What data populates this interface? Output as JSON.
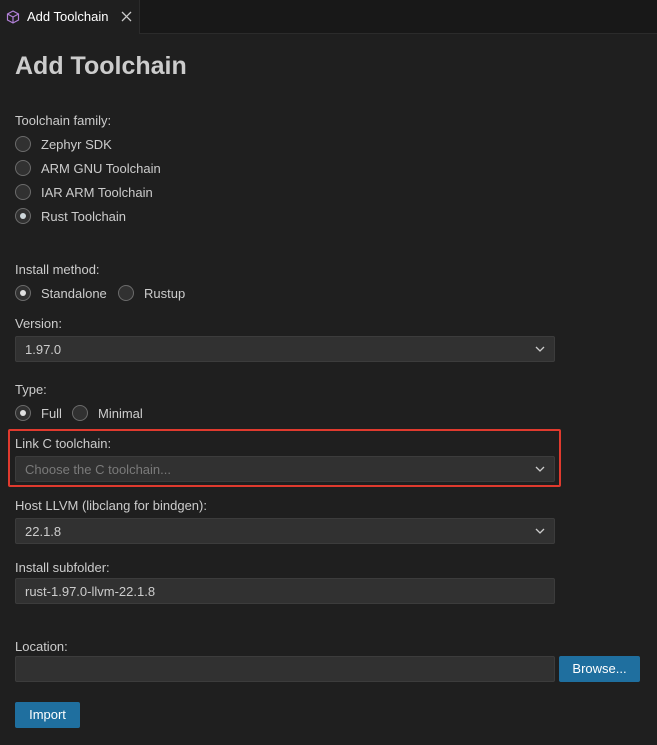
{
  "tab": {
    "title": "Add Toolchain",
    "icon": "package-icon",
    "close_icon": "close-icon"
  },
  "page": {
    "title": "Add Toolchain"
  },
  "family": {
    "label": "Toolchain family:",
    "options": [
      "Zephyr SDK",
      "ARM GNU Toolchain",
      "IAR ARM Toolchain",
      "Rust Toolchain"
    ],
    "selected": "Rust Toolchain"
  },
  "install_method": {
    "label": "Install method:",
    "options": [
      "Standalone",
      "Rustup"
    ],
    "selected": "Standalone"
  },
  "version": {
    "label": "Version:",
    "value": "1.97.0"
  },
  "type": {
    "label": "Type:",
    "options": [
      "Full",
      "Minimal"
    ],
    "selected": "Full"
  },
  "link_c": {
    "label": "Link C toolchain:",
    "placeholder": "Choose the C toolchain..."
  },
  "host_llvm": {
    "label": "Host LLVM (libclang for bindgen):",
    "value": "22.1.8"
  },
  "subfolder": {
    "label": "Install subfolder:",
    "value": "rust-1.97.0-llvm-22.1.8"
  },
  "location": {
    "label": "Location:",
    "value": ""
  },
  "buttons": {
    "browse": "Browse...",
    "import": "Import"
  },
  "colors": {
    "accent_button": "#1f6f9f",
    "highlight": "#e03a2e"
  }
}
